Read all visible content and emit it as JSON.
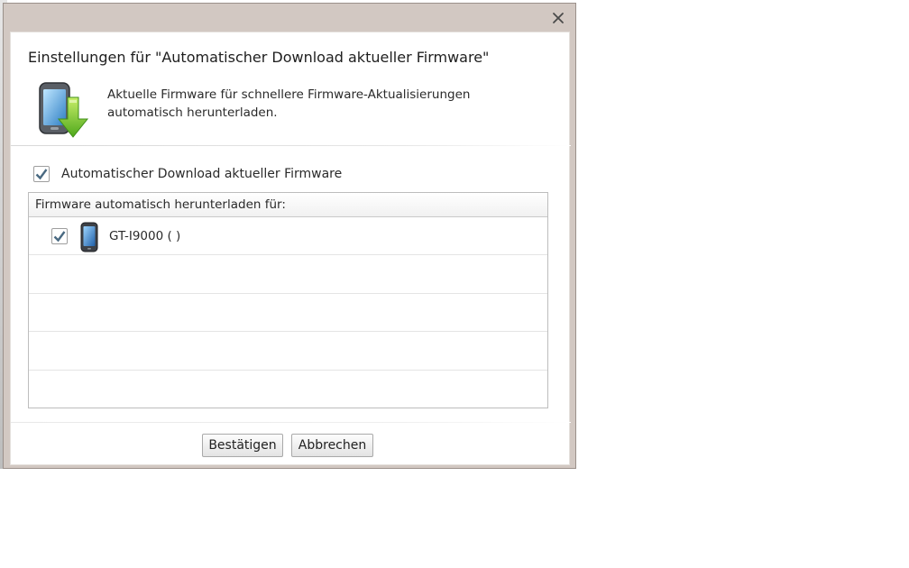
{
  "dialog": {
    "close_icon": "close-icon",
    "heading": "Einstellungen für \"Automatischer Download aktueller Firmware\"",
    "icon": "phone-download-icon",
    "description_line1": "Aktuelle Firmware für schnellere Firmware-Aktualisierungen",
    "description_line2": "automatisch herunterladen.",
    "auto_download": {
      "label": "Automatischer Download aktueller Firmware",
      "checked": true
    },
    "device_list": {
      "header": "Firmware automatisch herunterladen für:",
      "devices": [
        {
          "name": "GT-I9000 ( )",
          "checked": true,
          "icon": "phone-icon"
        }
      ]
    },
    "buttons": {
      "confirm": "Bestätigen",
      "cancel": "Abbrechen"
    }
  },
  "colors": {
    "frame": "#d2c8c2",
    "check_mark": "#4a6a82",
    "arrow_green": "#6fbf2a"
  }
}
